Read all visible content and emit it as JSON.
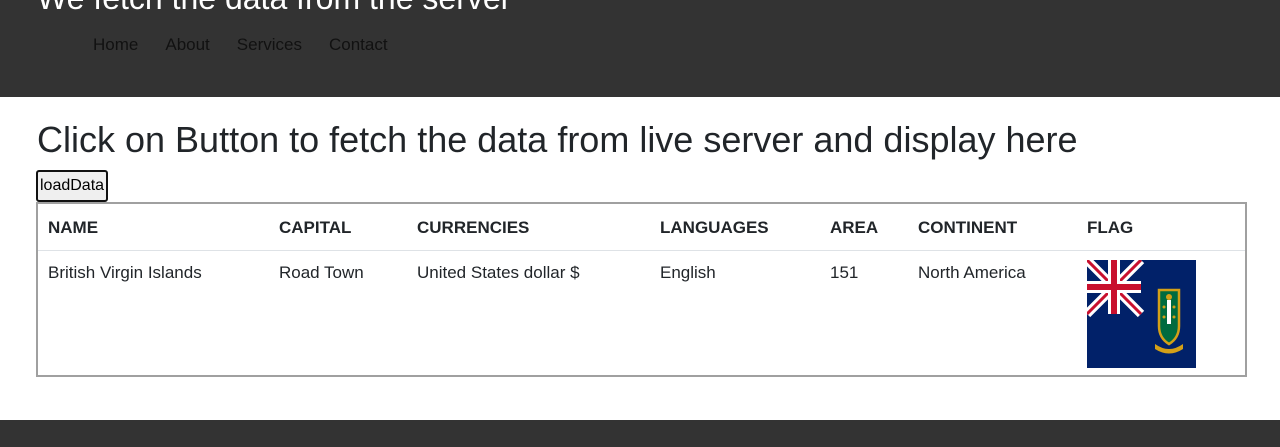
{
  "header": {
    "title": "We fetch the data from the server",
    "nav": [
      "Home",
      "About",
      "Services",
      "Contact"
    ]
  },
  "main": {
    "heading": "Click on Button to fetch the data from live server and display here",
    "load_button": "loadData"
  },
  "table": {
    "columns": [
      "NAME",
      "CAPITAL",
      "CURRENCIES",
      "LANGUAGES",
      "AREA",
      "CONTINENT",
      "FLAG"
    ],
    "rows": [
      {
        "name": "British Virgin Islands",
        "capital": "Road Town",
        "currencies": "United States dollar $",
        "languages": "English",
        "area": "151",
        "continent": "North America",
        "flag": "british-virgin-islands-flag"
      }
    ]
  },
  "colors": {
    "header_bg": "#333333",
    "flag_blue": "#012169",
    "flag_red": "#C8102E",
    "shield_green": "#006B3F",
    "gold": "#D4A017"
  }
}
